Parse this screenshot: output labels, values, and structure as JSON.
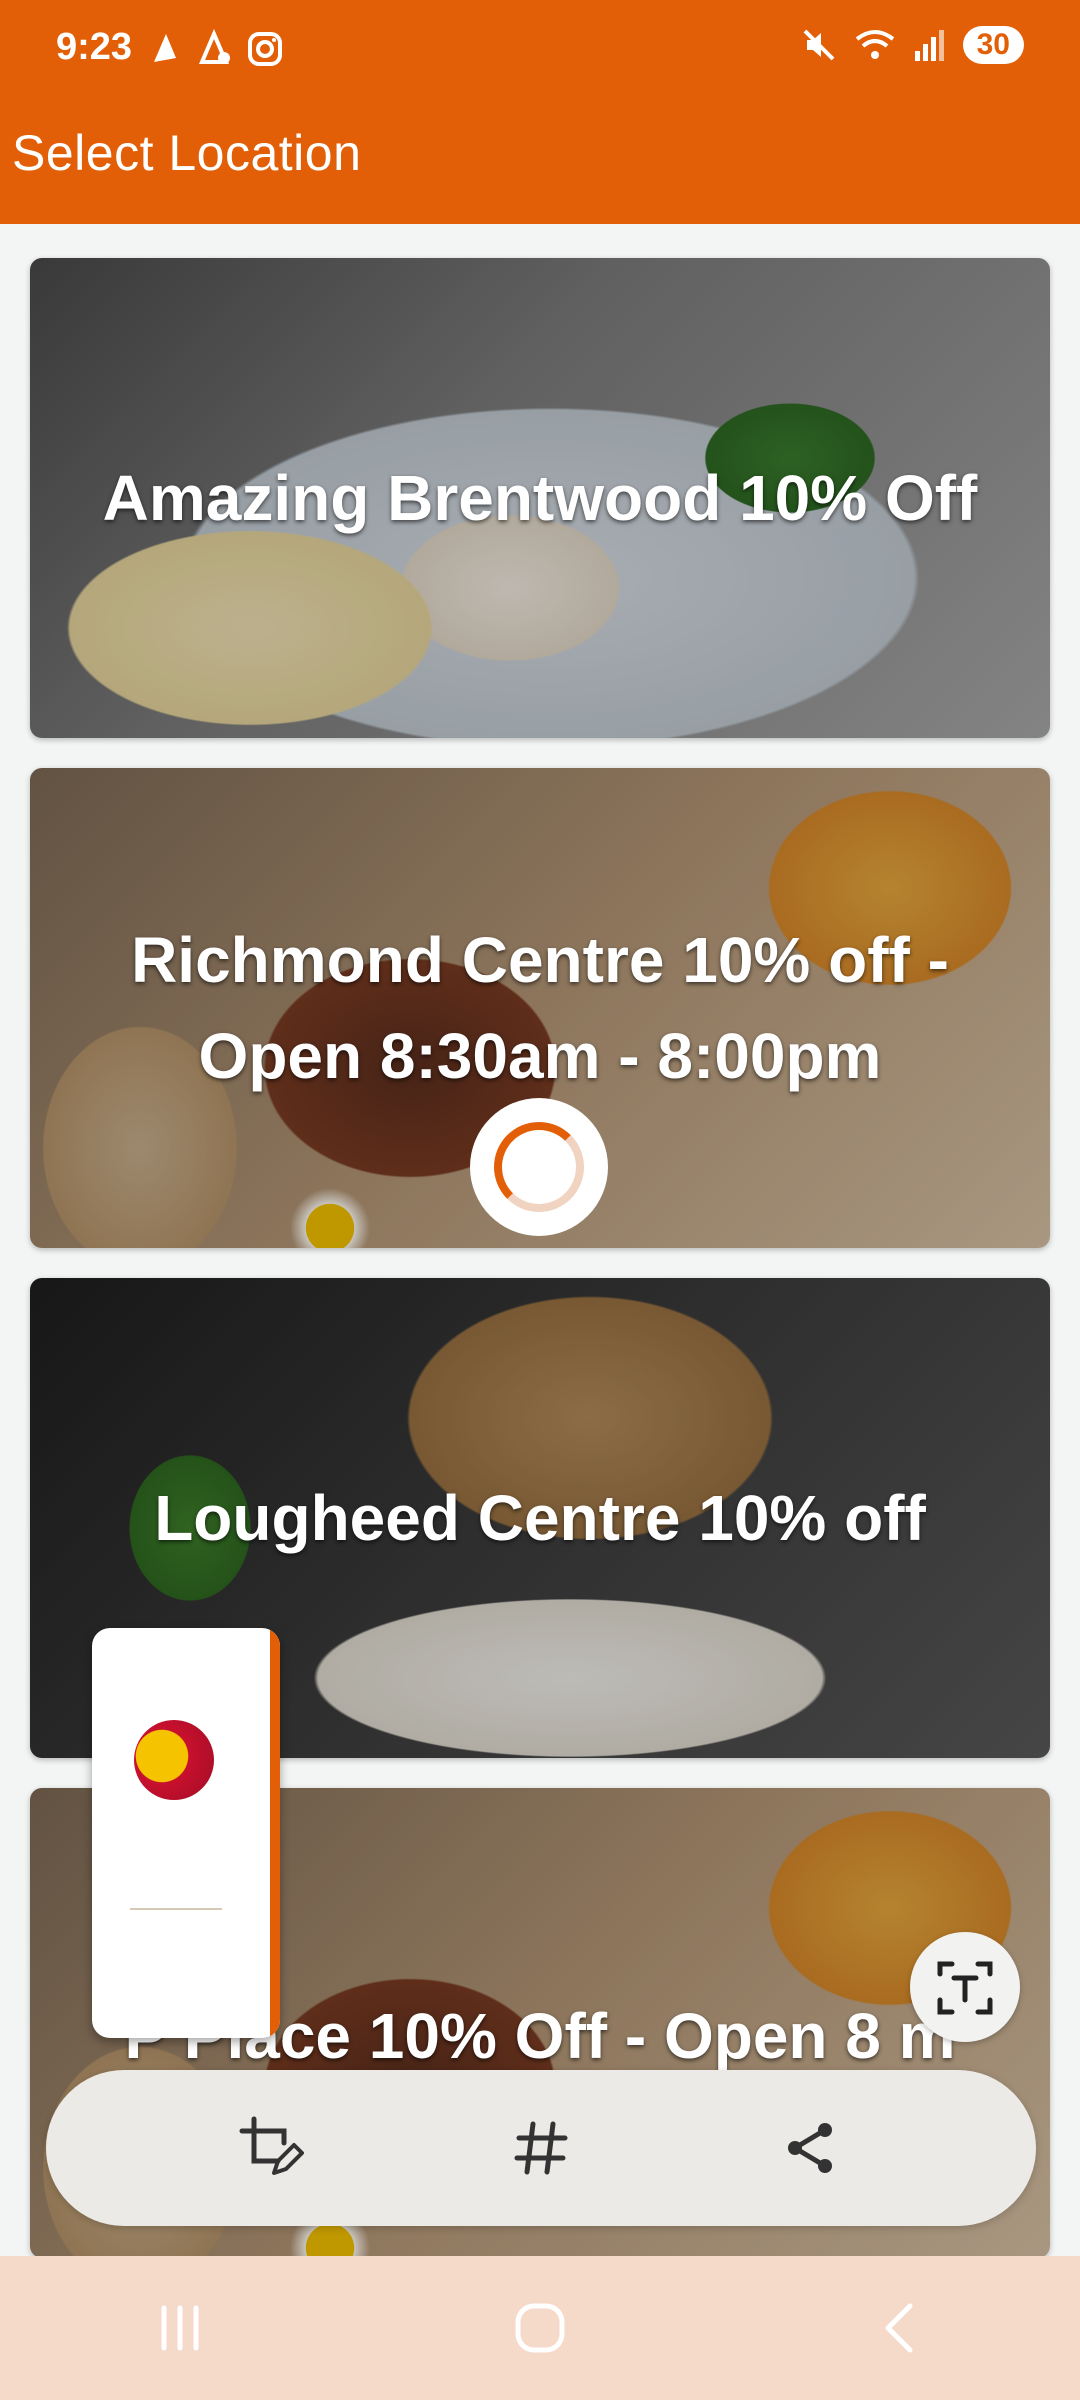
{
  "status_bar": {
    "time": "9:23",
    "battery": "30"
  },
  "app_bar": {
    "title": "Select Location"
  },
  "locations": [
    {
      "title": "Amazing Brentwood 10% Off"
    },
    {
      "title": "Richmond Centre 10% off - Open 8:30am - 8:00pm"
    },
    {
      "title": "Lougheed Centre 10% off"
    },
    {
      "title": "P      Place 10% Off - Open 8 m 7:30pm"
    }
  ],
  "screenshot_toolbar": {
    "buttons": [
      {
        "icon": "crop-edit-icon"
      },
      {
        "icon": "hashtag-icon"
      },
      {
        "icon": "share-icon"
      }
    ],
    "text_extract_icon": "text-extract-icon"
  },
  "colors": {
    "accent": "#e35f07",
    "nav_bar": "#f5dac9"
  }
}
